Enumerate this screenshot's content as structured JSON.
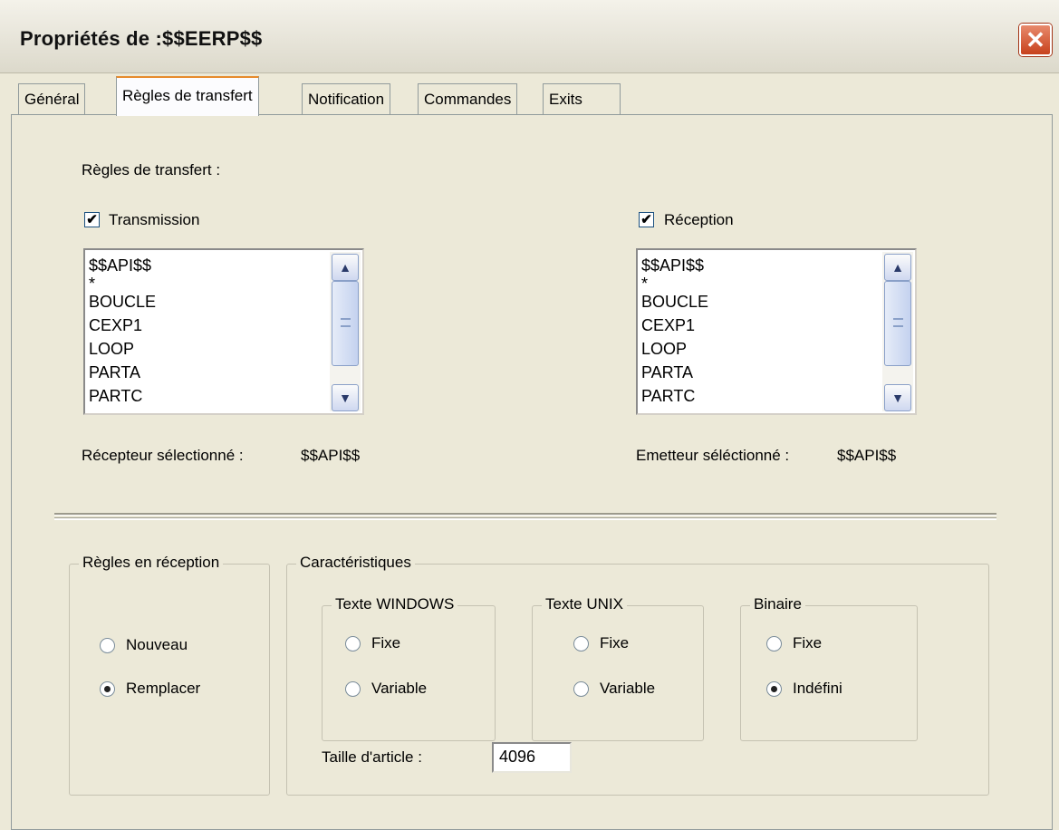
{
  "window": {
    "title": "Propriétés de :$$EERP$$",
    "close_glyph": "✕"
  },
  "tabs": [
    {
      "label": "Général",
      "active": false
    },
    {
      "label": "Règles de transfert",
      "active": true
    },
    {
      "label": "Notification",
      "active": false
    },
    {
      "label": "Commandes",
      "active": false
    },
    {
      "label": "Exits",
      "active": false
    }
  ],
  "transfer": {
    "heading": "Règles de transfert :",
    "transmission": {
      "label": "Transmission",
      "checked": true,
      "items": [
        "$$API$$",
        "*",
        "BOUCLE",
        "CEXP1",
        "LOOP",
        "PARTA",
        "PARTC"
      ],
      "selected_label": "Récepteur sélectionné :",
      "selected_value": "$$API$$"
    },
    "reception": {
      "label": "Réception",
      "checked": true,
      "items": [
        "$$API$$",
        "*",
        "BOUCLE",
        "CEXP1",
        "LOOP",
        "PARTA",
        "PARTC"
      ],
      "selected_label": "Emetteur séléctionné :",
      "selected_value": "$$API$$"
    }
  },
  "reception_rules": {
    "legend": "Règles en réception",
    "options": [
      "Nouveau",
      "Remplacer"
    ],
    "selected": "Remplacer"
  },
  "characteristics": {
    "legend": "Caractéristiques",
    "windows": {
      "legend": "Texte WINDOWS",
      "options": [
        "Fixe",
        "Variable"
      ],
      "selected": null
    },
    "unix": {
      "legend": "Texte UNIX",
      "options": [
        "Fixe",
        "Variable"
      ],
      "selected": null
    },
    "binary": {
      "legend": "Binaire",
      "options": [
        "Fixe",
        "Indéfini"
      ],
      "selected": "Indéfini"
    },
    "article_size_label": "Taille d'article :",
    "article_size_value": "4096"
  },
  "icons": {
    "checkmark": "✔",
    "scroll_up": "▲",
    "scroll_down": "▼"
  }
}
